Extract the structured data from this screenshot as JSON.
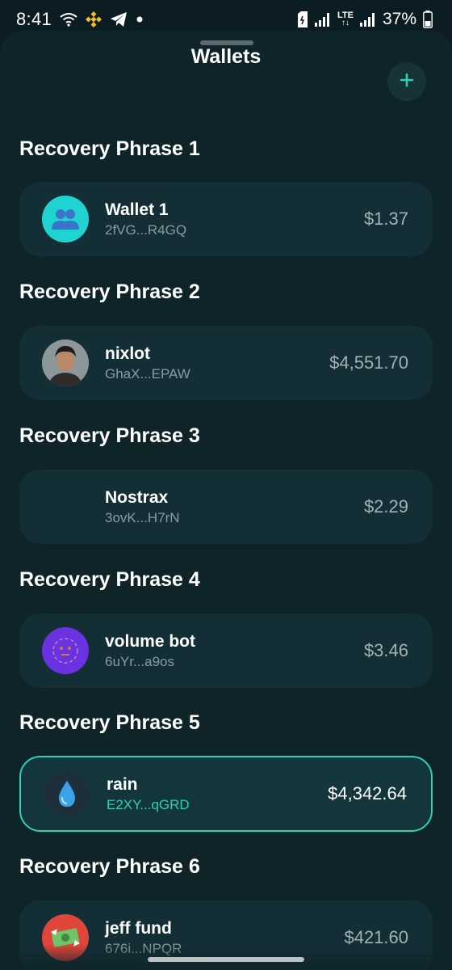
{
  "status_bar": {
    "time": "8:41",
    "battery_percent": "37%",
    "network_label": "LTE",
    "icons": [
      "wifi-icon",
      "binance-icon",
      "telegram-icon",
      "notification-dot-icon",
      "sim-icon",
      "signal-icon",
      "lte-icon",
      "signal-icon",
      "battery-icon"
    ]
  },
  "header": {
    "title": "Wallets",
    "add_label": "+"
  },
  "groups": [
    {
      "title": "Recovery Phrase 1",
      "wallet": {
        "name": "Wallet 1",
        "address": "2fVG...R4GQ",
        "balance": "$1.37",
        "avatar": "group-icon",
        "avatar_color": "#1fd3d3"
      }
    },
    {
      "title": "Recovery Phrase 2",
      "wallet": {
        "name": "nixlot",
        "address": "GhaX...EPAW",
        "balance": "$4,551.70",
        "avatar": "profile-photo",
        "avatar_color": "#6b7a7c"
      }
    },
    {
      "title": "Recovery Phrase 3",
      "wallet": {
        "name": "Nostrax",
        "address": "3ovK...H7rN",
        "balance": "$2.29",
        "avatar": "none",
        "avatar_color": "#132f35"
      }
    },
    {
      "title": "Recovery Phrase 4",
      "wallet": {
        "name": "volume bot",
        "address": "6uYr...a9os",
        "balance": "$3.46",
        "avatar": "bot-face-icon",
        "avatar_color": "#6a32e0"
      }
    },
    {
      "title": "Recovery Phrase 5",
      "wallet": {
        "name": "rain",
        "address": "E2XY...qGRD",
        "balance": "$4,342.64",
        "avatar": "droplet-icon",
        "avatar_color": "#1c2f3a",
        "selected": true
      }
    },
    {
      "title": "Recovery Phrase 6",
      "wallet": {
        "name": "jeff fund",
        "address": "676i...NPQR",
        "balance": "$421.60",
        "avatar": "money-icon",
        "avatar_color": "#e0453a"
      }
    }
  ],
  "colors": {
    "background": "#0b1d22",
    "sheet": "#0f2429",
    "card": "#132f35",
    "accent": "#2fcfb7"
  }
}
